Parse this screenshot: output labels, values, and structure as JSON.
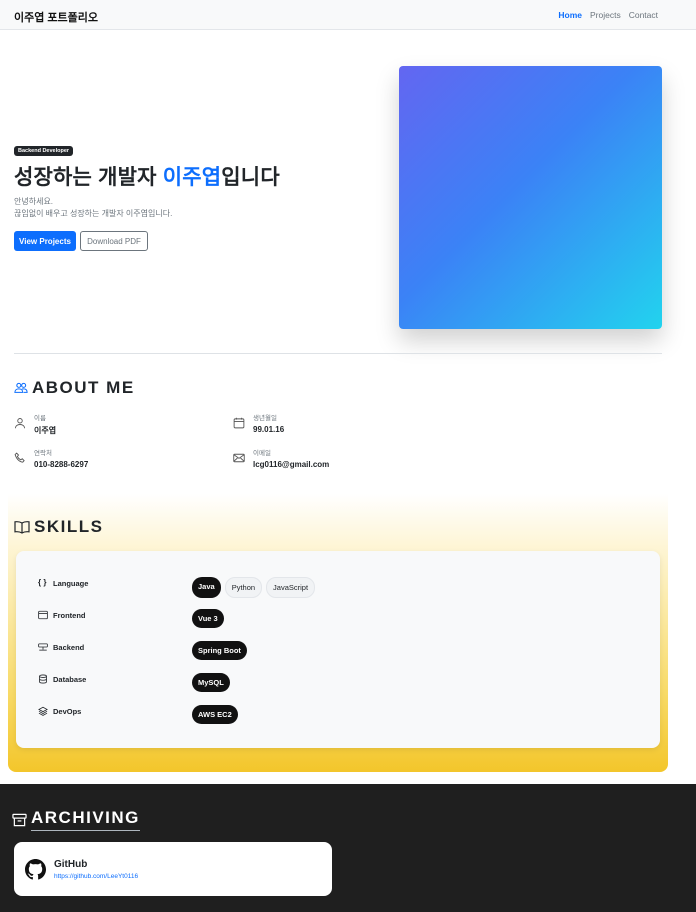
{
  "navbar": {
    "brand": "이주엽 포트폴리오",
    "links": [
      {
        "label": "Home",
        "active": true
      },
      {
        "label": "Projects",
        "active": false
      },
      {
        "label": "Contact",
        "active": false
      }
    ]
  },
  "hero": {
    "badge": "Backend Developer",
    "title_prefix": "성장하는 개발자 ",
    "title_name": "이주엽",
    "title_suffix": "입니다",
    "desc_line1": "안녕하세요.",
    "desc_line2": "끊임없이 배우고 성장하는 개발자 이주엽입니다.",
    "btn_primary": "View Projects",
    "btn_secondary": "Download PDF"
  },
  "about": {
    "title": "ABOUT ME",
    "items": [
      {
        "label": "이름",
        "value": "이주엽",
        "icon": "person-icon"
      },
      {
        "label": "생년월일",
        "value": "99.01.16",
        "icon": "calendar-icon"
      },
      {
        "label": "연락처",
        "value": "010-8288-6297",
        "icon": "phone-icon"
      },
      {
        "label": "이메일",
        "value": "lcg0116@gmail.com",
        "icon": "envelope-icon"
      }
    ]
  },
  "skills": {
    "title": "SKILLS",
    "rows": [
      {
        "category": "Language",
        "icon": "braces-icon",
        "items": [
          "Java",
          "Python",
          "JavaScript"
        ],
        "highlight": [
          true,
          false,
          false
        ]
      },
      {
        "category": "Frontend",
        "icon": "window-icon",
        "items": [
          "Vue 3"
        ],
        "highlight": [
          true
        ]
      },
      {
        "category": "Backend",
        "icon": "server-icon",
        "items": [
          "Spring Boot"
        ],
        "highlight": [
          true
        ]
      },
      {
        "category": "Database",
        "icon": "database-icon",
        "items": [
          "MySQL"
        ],
        "highlight": [
          true
        ]
      },
      {
        "category": "DevOps",
        "icon": "layers-icon",
        "items": [
          "AWS EC2"
        ],
        "highlight": [
          true
        ]
      }
    ]
  },
  "archiving": {
    "title": "ARCHIVING",
    "github_name": "GitHub",
    "github_url": "https://github.com/LeeYt0116"
  },
  "colors": {
    "accent": "#0d6efd",
    "dark": "#1f1f1f",
    "skills_gradient_end": "#f3c62b"
  }
}
